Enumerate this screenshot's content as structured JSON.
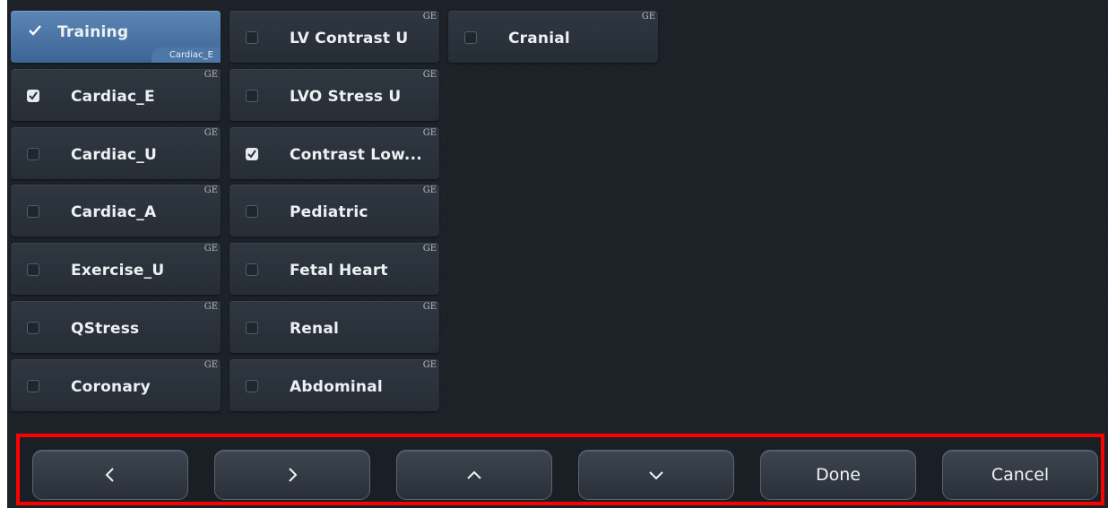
{
  "grid": {
    "col1": [
      {
        "label": "Training",
        "checked": true,
        "selected": true,
        "sublabel": "Cardiac_E"
      },
      {
        "label": "Cardiac_E",
        "checked": true,
        "badge": "GE"
      },
      {
        "label": "Cardiac_U",
        "checked": false,
        "badge": "GE"
      },
      {
        "label": "Cardiac_A",
        "checked": false,
        "badge": "GE"
      },
      {
        "label": "Exercise_U",
        "checked": false,
        "badge": "GE"
      },
      {
        "label": "QStress",
        "checked": false,
        "badge": "GE"
      },
      {
        "label": "Coronary",
        "checked": false,
        "badge": "GE"
      }
    ],
    "col2": [
      {
        "label": "LV Contrast U",
        "checked": false,
        "badge": "GE"
      },
      {
        "label": "LVO Stress U",
        "checked": false,
        "badge": "GE"
      },
      {
        "label": "Contrast Low...",
        "checked": true,
        "badge": "GE"
      },
      {
        "label": "Pediatric",
        "checked": false,
        "badge": "GE"
      },
      {
        "label": "Fetal Heart",
        "checked": false,
        "badge": "GE"
      },
      {
        "label": "Renal",
        "checked": false,
        "badge": "GE"
      },
      {
        "label": "Abdominal",
        "checked": false,
        "badge": "GE"
      }
    ],
    "col3": [
      {
        "label": "Cranial",
        "checked": false,
        "badge": "GE"
      }
    ]
  },
  "toolbar": {
    "prev_icon": "chevron-left-icon",
    "next_icon": "chevron-right-icon",
    "up_icon": "chevron-up-icon",
    "down_icon": "chevron-down-icon",
    "done_label": "Done",
    "cancel_label": "Cancel"
  },
  "colors": {
    "highlight_border": "#ff0000",
    "selected_tile": "#4c77a6",
    "tile": "#2b323b"
  }
}
